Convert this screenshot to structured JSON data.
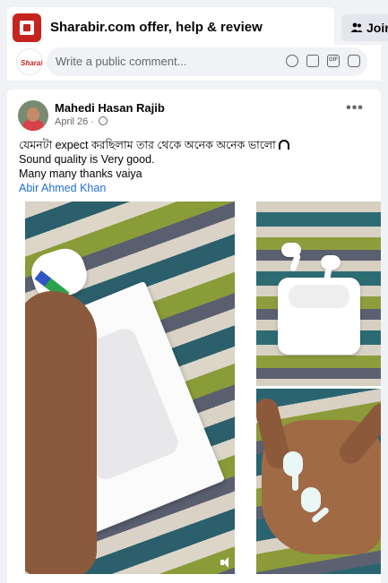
{
  "group": {
    "title": "Sharabir.com offer, help & review",
    "join_label": "Join"
  },
  "comment_bar": {
    "avatar_mark": "Sharabir",
    "placeholder": "Write a public comment...",
    "icons": [
      "emoji-icon",
      "camera-icon",
      "gif-icon",
      "sticker-icon"
    ],
    "gif_label": "GIF"
  },
  "post": {
    "author": "Mahedi Hasan Rajib",
    "date": "April 26",
    "more_label": "•••",
    "lines": [
      "যেমনটা expect করছিলাম তার থেকে অনেক অনেক ভালো",
      "Sound quality is Very good.",
      "Many many thanks vaiya"
    ],
    "mention": "Abir Ahmed Khan"
  },
  "colors": {
    "accent_link": "#216fdb",
    "brand_red": "#c4241d",
    "background": "#f0f2f5"
  }
}
